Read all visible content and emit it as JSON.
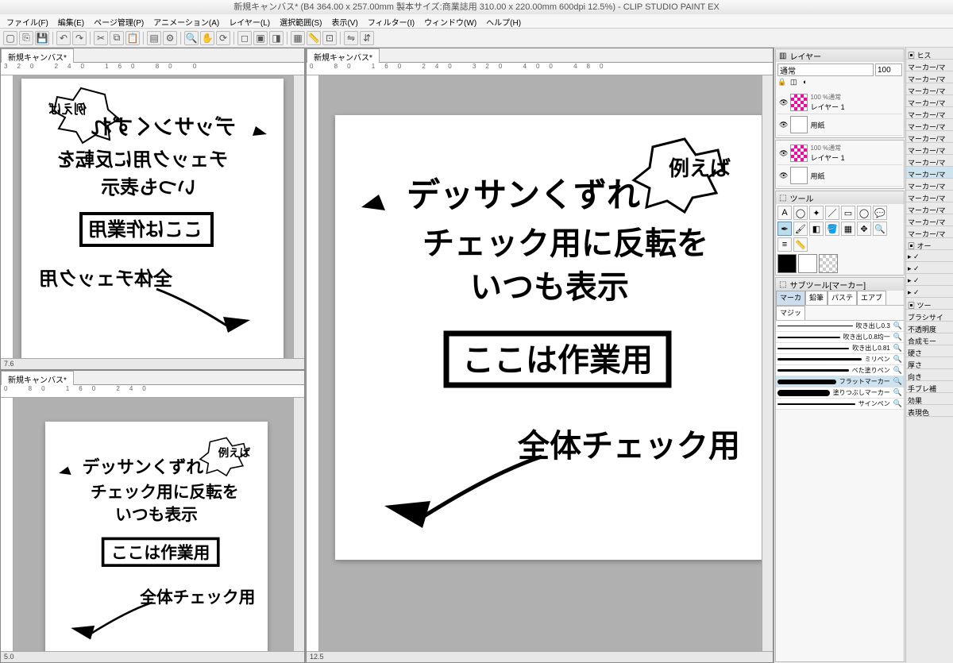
{
  "title": "新規キャンバス* (B4 364.00 x 257.00mm 製本サイズ:商業誌用 310.00 x 220.00mm 600dpi 12.5%) - CLIP STUDIO PAINT EX",
  "menu": [
    "ファイル(F)",
    "編集(E)",
    "ページ管理(P)",
    "アニメーション(A)",
    "レイヤー(L)",
    "選択範囲(S)",
    "表示(V)",
    "フィルター(I)",
    "ウィンドウ(W)",
    "ヘルプ(H)"
  ],
  "tabs": {
    "a": "新規キャンバス*",
    "b": "新規キャンバス*",
    "c": "新規キャンバス*"
  },
  "rulerLabels": [
    "320",
    "240",
    "160",
    "80",
    "0"
  ],
  "rulerLabelsCenter": [
    "0",
    "80",
    "160",
    "240",
    "320"
  ],
  "statusA": "7.6",
  "statusB": "5.0",
  "statusC": "12.5",
  "layerPanelTitle": "レイヤー",
  "blendMode": "通常",
  "opacity": "100",
  "layers": [
    {
      "name": "レイヤー 1",
      "sub": "100 %通常",
      "pink": true
    },
    {
      "name": "用紙",
      "sub": "",
      "pink": false
    }
  ],
  "toolPanelTitle": "ツール",
  "subtoolTitle": "サブツール[マーカー]",
  "subtoolTabs": [
    "マーカ",
    "鉛筆",
    "パステ",
    "エアブ"
  ],
  "subtoolExtra": "マジッ",
  "brushes": [
    {
      "name": "吹き出し0.3",
      "w": 1
    },
    {
      "name": "吹き出し0.8均一",
      "w": 2
    },
    {
      "name": "吹き出し0.81",
      "w": 2
    },
    {
      "name": "ミリペン",
      "w": 3
    },
    {
      "name": "べた塗りペン",
      "w": 3
    },
    {
      "name": "フラットマーカー",
      "w": 6,
      "sel": true
    },
    {
      "name": "塗りつぶしマーカー",
      "w": 8
    },
    {
      "name": "サインペン",
      "w": 2
    }
  ],
  "historyTitle": "ヒス",
  "historyItems": [
    "マーカー/マ",
    "マーカー/マ",
    "マーカー/マ",
    "マーカー/マ",
    "マーカー/マ",
    "マーカー/マ",
    "マーカー/マ",
    "マーカー/マ",
    "マーカー/マ",
    "マーカー/マ",
    "マーカー/マ",
    "マーカー/マ",
    "マーカー/マ",
    "マーカー/マ",
    "マーカー/マ"
  ],
  "autoTitle": "オー",
  "effectTitle": "効果",
  "expressColor": "表現色",
  "toolPropTitle": "ツー",
  "props": [
    "ブラシサイ",
    "不透明度",
    "合成モー",
    "硬さ",
    "厚さ",
    "向き",
    "手ブレ補"
  ],
  "canvasText": {
    "bubble": "例えば",
    "l1": "デッサンくずれ",
    "l2": "チェック用に反転を",
    "l3": "いつも表示",
    "box": "ここは作業用",
    "l4": "全体チェック用"
  }
}
